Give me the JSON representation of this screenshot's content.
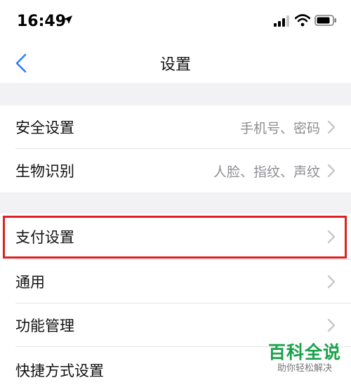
{
  "status_bar": {
    "time": "16:49"
  },
  "nav": {
    "title": "设置"
  },
  "rows": [
    {
      "label": "安全设置",
      "value": "手机号、密码"
    },
    {
      "label": "生物识别",
      "value": "人脸、指纹、声纹"
    },
    {
      "label": "支付设置",
      "value": ""
    },
    {
      "label": "通用",
      "value": ""
    },
    {
      "label": "功能管理",
      "value": ""
    },
    {
      "label": "快捷方式设置",
      "value": ""
    }
  ],
  "watermark": {
    "title": "百科全说",
    "subtitle": "助你轻松解决"
  },
  "colors": {
    "accent": "#2f7df6",
    "highlight_border": "#e02020",
    "section_gap": "#f2f2f4",
    "secondary_text": "#8e8e93",
    "watermark_green": "#1aa14a"
  },
  "icons": {
    "location": "location-arrow-icon",
    "signal": "cellular-signal-icon",
    "wifi": "wifi-icon",
    "battery": "battery-icon",
    "back": "chevron-left-icon",
    "row_chevron": "chevron-right-icon"
  }
}
